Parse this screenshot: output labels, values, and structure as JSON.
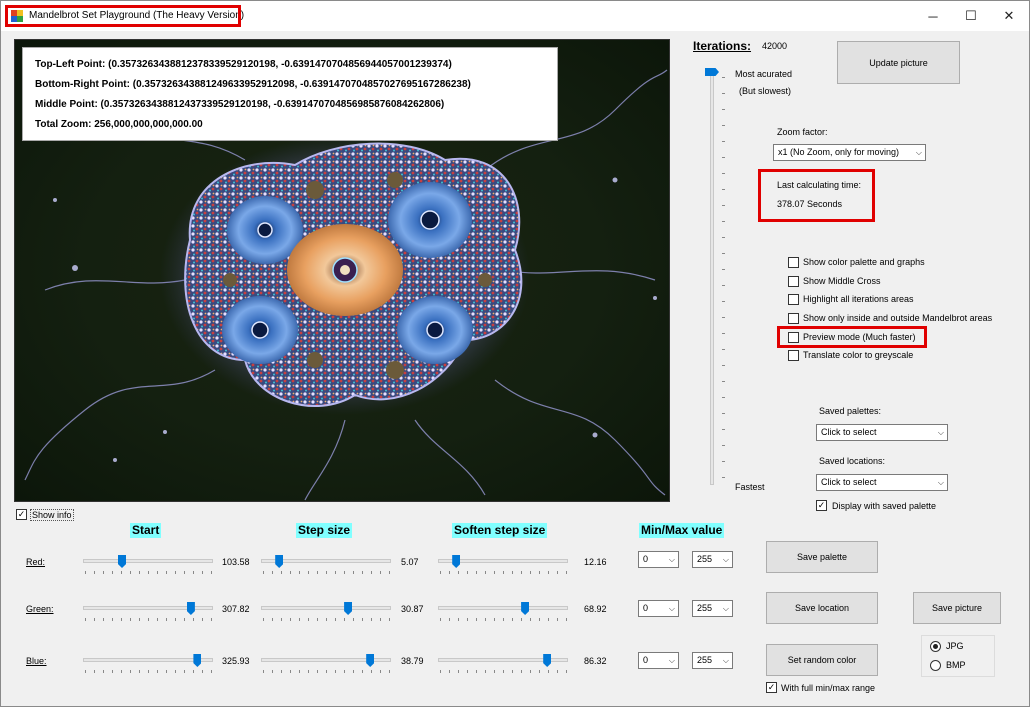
{
  "window": {
    "title": "Mandelbrot Set Playground (The Heavy Version)",
    "controls": {
      "minimize": "─",
      "maximize": "☐",
      "close": "✕"
    }
  },
  "info": {
    "top_left": "Top-Left  Point:  (0.357326343881237833952912019​8,  -0.6391470704856944057001239374)",
    "bottom_right": "Bottom-Right  Point:  (0.35732634388124963395291209​8,  -0.6391470704857027695167286238)",
    "middle": "Middle  Point:  (0.357326343881243733952912019​8,  -0.6391470704856985876084262806)",
    "zoom": "Total Zoom: 256,000,000,000,000.00"
  },
  "iterations": {
    "label": "Iterations:",
    "value": "42000",
    "most_accurate": "Most acurated",
    "but_slowest": "(But slowest)",
    "fastest": "Fastest"
  },
  "update_button": "Update picture",
  "zoom": {
    "label": "Zoom factor:",
    "selected": "x1 (No Zoom, only for moving)"
  },
  "calc_time": {
    "label": "Last calculating time:",
    "value": "378.07 Seconds"
  },
  "options": [
    {
      "label": "Show color palette and graphs",
      "checked": false
    },
    {
      "label": "Show Middle Cross",
      "checked": false
    },
    {
      "label": "Highlight all iterations areas",
      "checked": false
    },
    {
      "label": "Show only inside and outside Mandelbrot areas",
      "checked": false
    },
    {
      "label": "Preview mode (Much faster)",
      "checked": false
    },
    {
      "label": "Translate color to greyscale",
      "checked": false
    }
  ],
  "saved_palettes": {
    "label": "Saved palettes:",
    "selected": "Click to select"
  },
  "saved_locations": {
    "label": "Saved locations:",
    "selected": "Click to select"
  },
  "display_saved_palette": {
    "label": "Display with saved palette",
    "checked": true
  },
  "show_info": {
    "label": "Show info",
    "checked": true
  },
  "headers": {
    "start": "Start",
    "step": "Step size",
    "soften": "Soften step size",
    "minmax": "Min/Max value"
  },
  "channels": [
    {
      "label": "Red:",
      "start": "103.58",
      "step": "5.07",
      "soften": "12.16",
      "min": "0",
      "max": "255",
      "start_pos": 0.3,
      "step_pos": 0.14,
      "soften_pos": 0.14
    },
    {
      "label": "Green:",
      "start": "307.82",
      "step": "30.87",
      "soften": "68.92",
      "min": "0",
      "max": "255",
      "start_pos": 0.83,
      "step_pos": 0.67,
      "soften_pos": 0.67
    },
    {
      "label": "Blue:",
      "start": "325.93",
      "step": "38.79",
      "soften": "86.32",
      "min": "0",
      "max": "255",
      "start_pos": 0.88,
      "step_pos": 0.84,
      "soften_pos": 0.84
    }
  ],
  "buttons": {
    "save_palette": "Save  palette",
    "save_location": "Save location",
    "save_picture": "Save picture",
    "random_color": "Set random color"
  },
  "full_range": {
    "label": "With full min/max range",
    "checked": true
  },
  "format": {
    "jpg": "JPG",
    "bmp": "BMP",
    "selected": "JPG"
  },
  "colors": {
    "highlight_red": "#e00000",
    "header_cyan": "#80ffff",
    "accent_blue": "#0078d7"
  }
}
